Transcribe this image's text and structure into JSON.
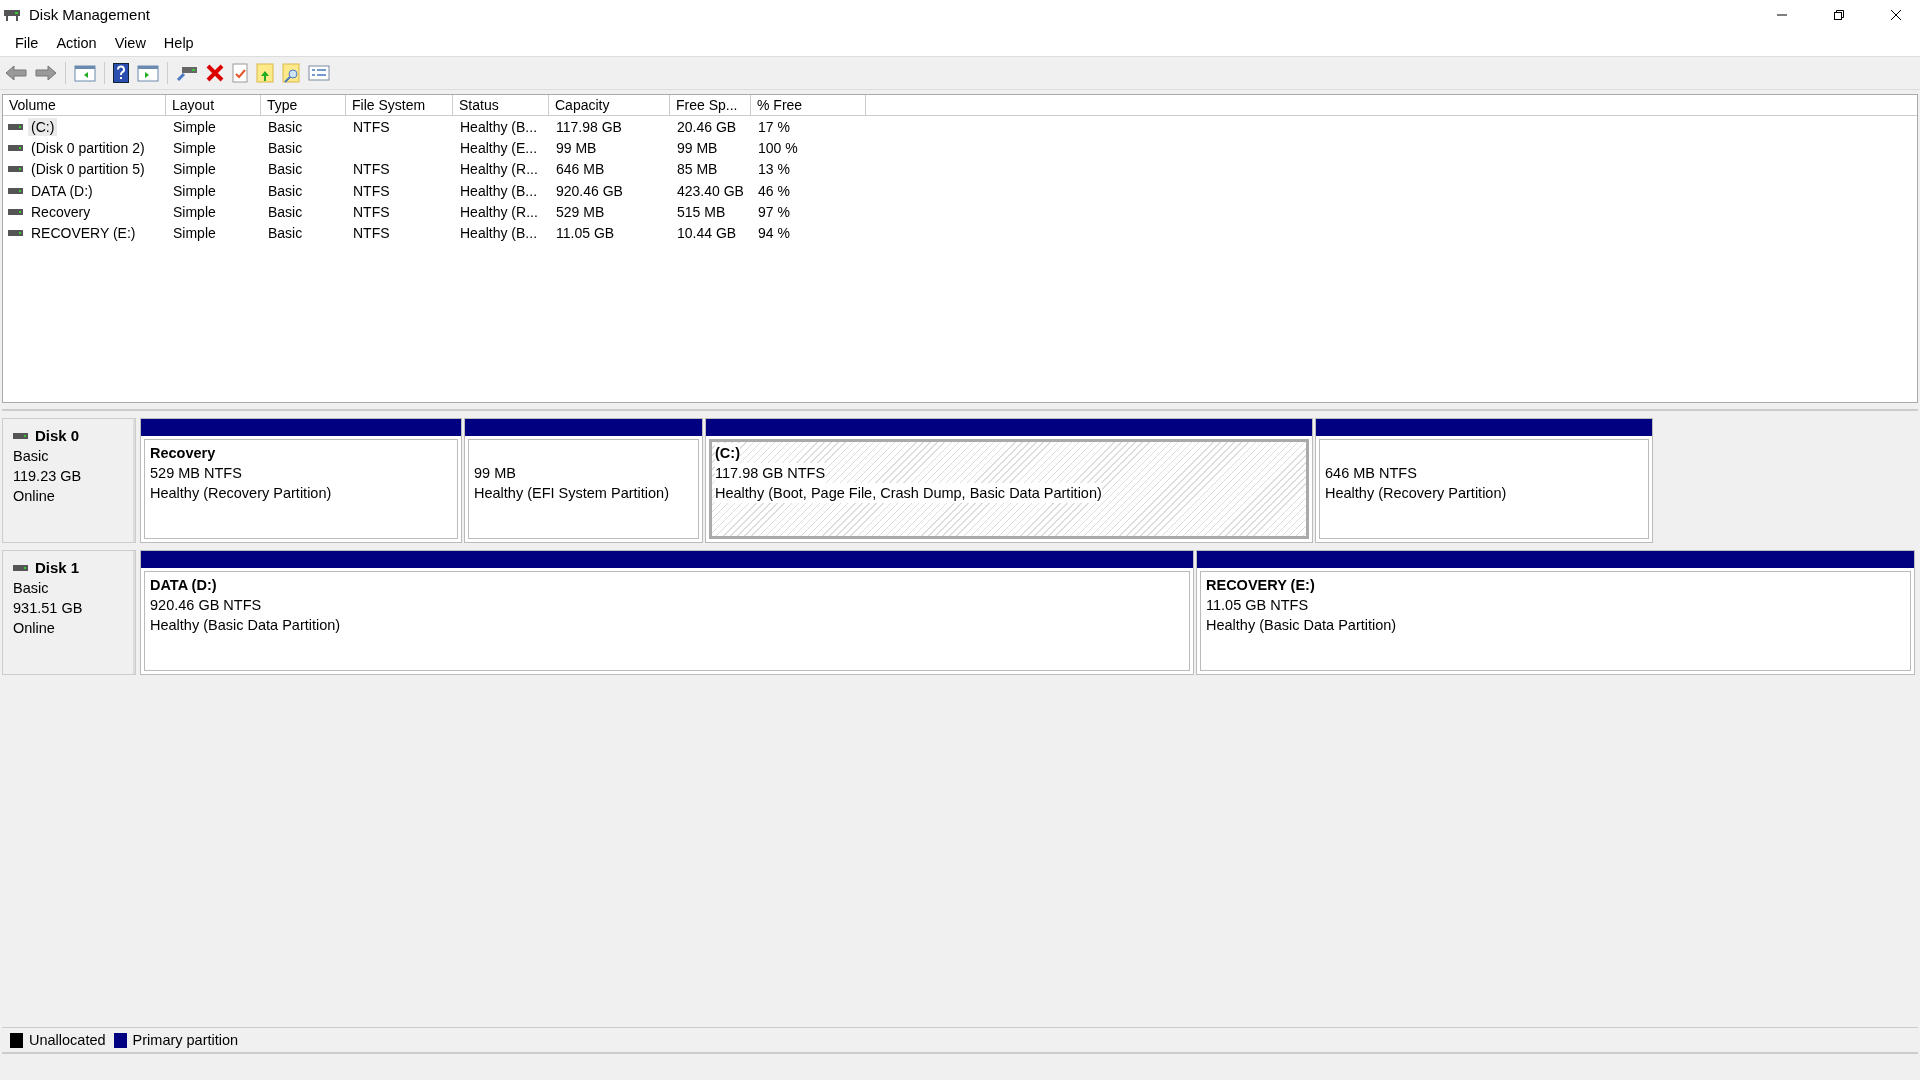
{
  "window": {
    "title": "Disk Management"
  },
  "menu": [
    "File",
    "Action",
    "View",
    "Help"
  ],
  "table": {
    "columns": [
      "Volume",
      "Layout",
      "Type",
      "File System",
      "Status",
      "Capacity",
      "Free Sp...",
      "% Free"
    ],
    "rows": [
      {
        "selected": true,
        "cells": [
          "(C:)",
          "Simple",
          "Basic",
          "NTFS",
          "Healthy (B...",
          "117.98 GB",
          "20.46 GB",
          "17 %"
        ]
      },
      {
        "selected": false,
        "cells": [
          "(Disk 0 partition 2)",
          "Simple",
          "Basic",
          "",
          "Healthy (E...",
          "99 MB",
          "99 MB",
          "100 %"
        ]
      },
      {
        "selected": false,
        "cells": [
          "(Disk 0 partition 5)",
          "Simple",
          "Basic",
          "NTFS",
          "Healthy (R...",
          "646 MB",
          "85 MB",
          "13 %"
        ]
      },
      {
        "selected": false,
        "cells": [
          "DATA (D:)",
          "Simple",
          "Basic",
          "NTFS",
          "Healthy (B...",
          "920.46 GB",
          "423.40 GB",
          "46 %"
        ]
      },
      {
        "selected": false,
        "cells": [
          "Recovery",
          "Simple",
          "Basic",
          "NTFS",
          "Healthy (R...",
          "529 MB",
          "515 MB",
          "97 %"
        ]
      },
      {
        "selected": false,
        "cells": [
          "RECOVERY (E:)",
          "Simple",
          "Basic",
          "NTFS",
          "Healthy (B...",
          "11.05 GB",
          "10.44 GB",
          "94 %"
        ]
      }
    ]
  },
  "disks": [
    {
      "name": "Disk 0",
      "type": "Basic",
      "size": "119.23 GB",
      "status": "Online",
      "partitions": [
        {
          "name": "Recovery",
          "size": "529 MB NTFS",
          "status": "Healthy (Recovery Partition)",
          "selected": false
        },
        {
          "size": "99 MB",
          "status": "Healthy (EFI System Partition)",
          "selected": false
        },
        {
          "name": "(C:)",
          "size": "117.98 GB NTFS",
          "status": "Healthy (Boot, Page File, Crash Dump, Basic Data Partition)",
          "selected": true
        },
        {
          "size": "646 MB NTFS",
          "status": "Healthy (Recovery Partition)",
          "selected": false
        }
      ]
    },
    {
      "name": "Disk 1",
      "type": "Basic",
      "size": "931.51 GB",
      "status": "Online",
      "partitions": [
        {
          "name": "DATA  (D:)",
          "size": "920.46 GB NTFS",
          "status": "Healthy (Basic Data Partition)",
          "selected": false
        },
        {
          "name": "RECOVERY  (E:)",
          "size": "11.05 GB NTFS",
          "status": "Healthy (Basic Data Partition)",
          "selected": false
        }
      ]
    }
  ],
  "legend": [
    {
      "label": "Unallocated",
      "color": "#000000"
    },
    {
      "label": "Primary partition",
      "color": "#000080"
    }
  ]
}
